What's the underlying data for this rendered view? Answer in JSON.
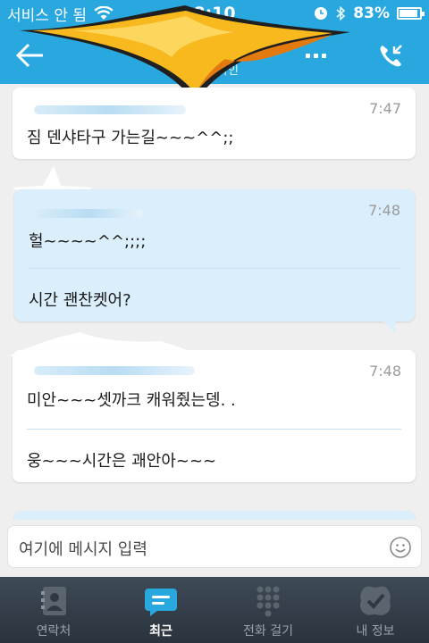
{
  "status": {
    "carrier": "서비스 안 됨",
    "time": "8:10",
    "battery_pct": "83%",
    "battery_level": 0.83
  },
  "header": {
    "title": "",
    "subtitle": "·오프라인"
  },
  "messages": [
    {
      "direction": "in",
      "time": "7:47",
      "lines": [
        "짐 덴샤타구 가는길~~~^^;;"
      ]
    },
    {
      "direction": "out",
      "time": "7:48",
      "lines": [
        "헐~~~~^^;;;;",
        "시간 괜찬켓어?"
      ]
    },
    {
      "direction": "in",
      "time": "7:48",
      "lines": [
        "미안~~~셋까크 캐워줬는뎅. .",
        "웅~~~시간은  괘안아~~~"
      ]
    }
  ],
  "input": {
    "placeholder": "여기에 메시지 입력"
  },
  "tabs": [
    {
      "label": "연락처",
      "icon": "contacts-icon",
      "active": false
    },
    {
      "label": "최근",
      "icon": "recent-chat-icon",
      "active": true
    },
    {
      "label": "전화 걸기",
      "icon": "dialpad-icon",
      "active": false
    },
    {
      "label": "내 정보",
      "icon": "my-info-icon",
      "active": false
    }
  ],
  "colors": {
    "accent": "#29a8e0",
    "outgoing_bubble": "#daeefb",
    "incoming_bubble": "#ffffff",
    "tab_bar": "#2f3943",
    "star_overlay": "#f7b91d"
  }
}
